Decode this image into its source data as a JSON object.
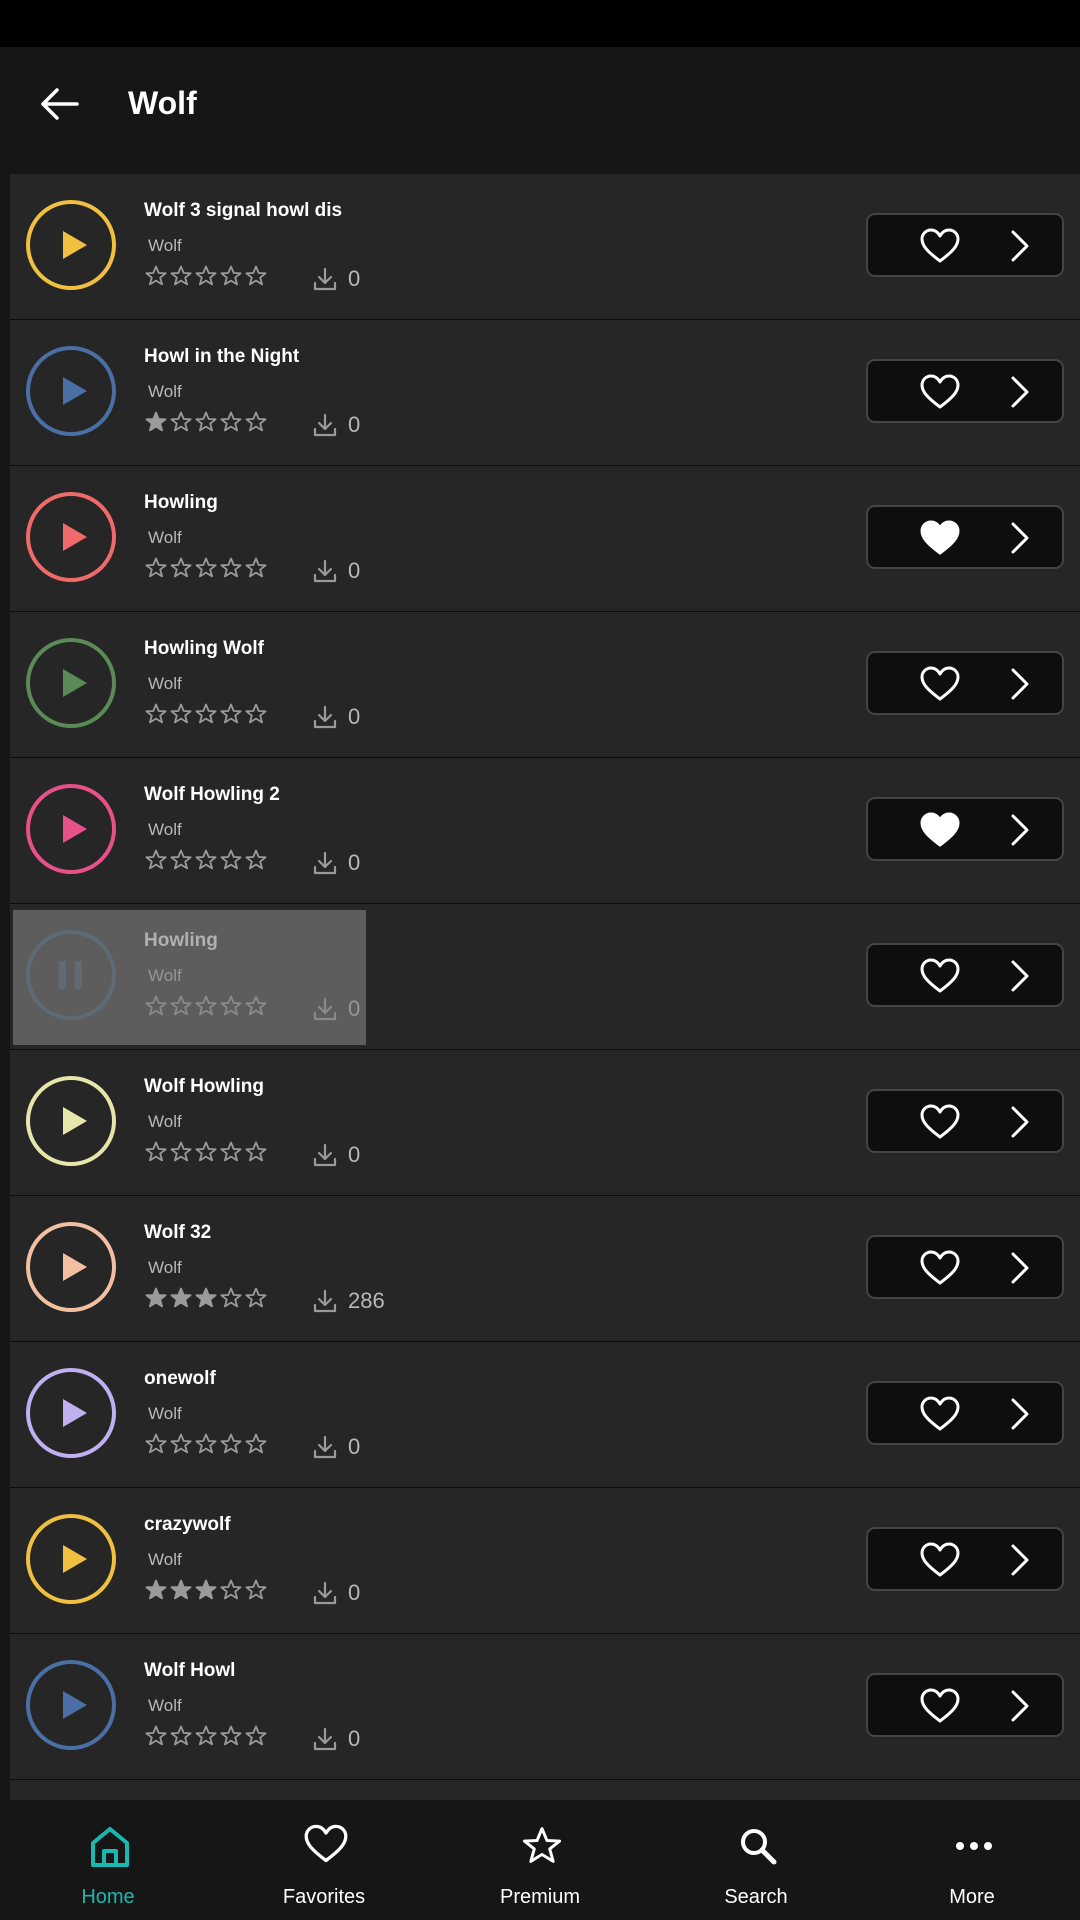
{
  "header": {
    "title": "Wolf"
  },
  "colors": {
    "accent": "#19b8b0",
    "background": "#161616",
    "row": "#262626"
  },
  "items": [
    {
      "title": "Wolf 3 signal howl dis",
      "artist": "Wolf",
      "rating": 0,
      "downloads": "0",
      "favorite": false,
      "color": "#f0c040",
      "state": "play"
    },
    {
      "title": "Howl in the Night",
      "artist": "Wolf",
      "rating": 1,
      "downloads": "0",
      "favorite": false,
      "color": "#4a6fa5",
      "state": "play"
    },
    {
      "title": "Howling",
      "artist": "Wolf",
      "rating": 0,
      "downloads": "0",
      "favorite": true,
      "color": "#f06a6a",
      "state": "play"
    },
    {
      "title": "Howling Wolf",
      "artist": "Wolf",
      "rating": 0,
      "downloads": "0",
      "favorite": false,
      "color": "#5a8a55",
      "state": "play"
    },
    {
      "title": "Wolf Howling 2",
      "artist": "Wolf",
      "rating": 0,
      "downloads": "0",
      "favorite": true,
      "color": "#e8508a",
      "state": "play"
    },
    {
      "title": "Howling",
      "artist": "Wolf",
      "rating": 0,
      "downloads": "0",
      "favorite": false,
      "color": "#2a4a62",
      "state": "pause"
    },
    {
      "title": "Wolf Howling",
      "artist": "Wolf",
      "rating": 0,
      "downloads": "0",
      "favorite": false,
      "color": "#e6e6aa",
      "state": "play"
    },
    {
      "title": "Wolf 32",
      "artist": "Wolf",
      "rating": 3,
      "downloads": "286",
      "favorite": false,
      "color": "#f2c0a0",
      "state": "play"
    },
    {
      "title": "onewolf",
      "artist": "Wolf",
      "rating": 0,
      "downloads": "0",
      "favorite": false,
      "color": "#c0b0f0",
      "state": "play"
    },
    {
      "title": "crazywolf",
      "artist": "Wolf",
      "rating": 3,
      "downloads": "0",
      "favorite": false,
      "color": "#f0c040",
      "state": "play"
    },
    {
      "title": "Wolf Howl",
      "artist": "Wolf",
      "rating": 0,
      "downloads": "0",
      "favorite": false,
      "color": "#4a6fa5",
      "state": "play"
    }
  ],
  "nav": [
    {
      "label": "Home",
      "icon": "home-icon",
      "active": true
    },
    {
      "label": "Favorites",
      "icon": "heart-icon",
      "active": false
    },
    {
      "label": "Premium",
      "icon": "star-icon",
      "active": false
    },
    {
      "label": "Search",
      "icon": "search-icon",
      "active": false
    },
    {
      "label": "More",
      "icon": "more-icon",
      "active": false
    }
  ]
}
